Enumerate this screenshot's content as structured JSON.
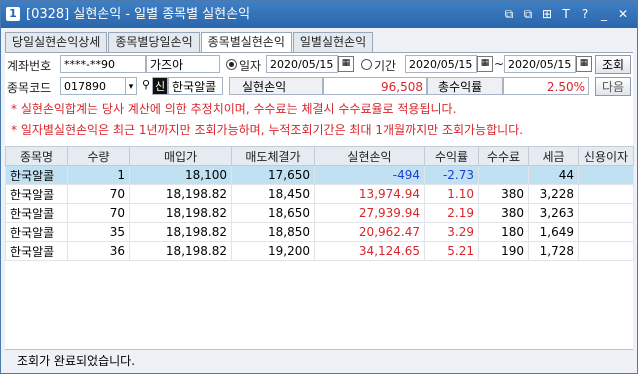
{
  "window": {
    "number": "1",
    "title": "[0328] 실현손익 - 일별 종목별 실현손익"
  },
  "titlebar_icons": [
    "window-restore-icon",
    "copy-icon",
    "pin-icon",
    "font-icon",
    "help-icon",
    "minimize-icon",
    "close-icon"
  ],
  "titlebar_icon_glyphs": [
    "⧉",
    "⧉",
    "⊞",
    "T",
    "?",
    "_",
    "✕"
  ],
  "tabs": [
    "당일실현손익상세",
    "종목별당일손익",
    "종목별실현손익",
    "일별실현손익"
  ],
  "active_tab": 2,
  "form": {
    "account_label": "계좌번호",
    "account_value": "****-**90",
    "account_name": "가즈아",
    "radio_date_label": "일자",
    "radio_period_label": "기간",
    "date_single": "2020/05/15",
    "date_from": "2020/05/15",
    "date_sep": "~",
    "date_to": "2020/05/15",
    "query_button": "조회",
    "next_button": "다음",
    "code_label": "종목코드",
    "code_value": "017890",
    "credit_tag": "신",
    "stock_name": "한국알콜",
    "realized_label": "실현손익",
    "realized_value": "96,508",
    "return_label": "총수익률",
    "return_value": "2.50%"
  },
  "notices": [
    "* 실현손익합계는 당사 계산에 의한 추정치이며, 수수료는 체결시 수수료율로 적용됩니다.",
    "* 일자별실현손익은 최근 1년까지만 조회가능하며, 누적조회기간은 최대 1개월까지만 조회가능합니다."
  ],
  "table": {
    "headers": [
      "종목명",
      "수량",
      "매입가",
      "매도체결가",
      "실현손익",
      "수익률",
      "수수료",
      "세금",
      "신용이자"
    ],
    "rows": [
      {
        "name": "한국알콜",
        "qty": "1",
        "buy": "18,100",
        "sell": "17,650",
        "pnl": "-494",
        "rate": "-2.73",
        "fee": "",
        "tax": "44",
        "interest": "",
        "sign": "neg"
      },
      {
        "name": "한국알콜",
        "qty": "70",
        "buy": "18,198.82",
        "sell": "18,450",
        "pnl": "13,974.94",
        "rate": "1.10",
        "fee": "380",
        "tax": "3,228",
        "interest": "",
        "sign": "pos"
      },
      {
        "name": "한국알콜",
        "qty": "70",
        "buy": "18,198.82",
        "sell": "18,650",
        "pnl": "27,939.94",
        "rate": "2.19",
        "fee": "380",
        "tax": "3,263",
        "interest": "",
        "sign": "pos"
      },
      {
        "name": "한국알콜",
        "qty": "35",
        "buy": "18,198.82",
        "sell": "18,850",
        "pnl": "20,962.47",
        "rate": "3.29",
        "fee": "180",
        "tax": "1,649",
        "interest": "",
        "sign": "pos"
      },
      {
        "name": "한국알콜",
        "qty": "36",
        "buy": "18,198.82",
        "sell": "19,200",
        "pnl": "34,124.65",
        "rate": "5.21",
        "fee": "190",
        "tax": "1,728",
        "interest": "",
        "sign": "pos"
      }
    ]
  },
  "status_text": "조회가 완료되었습니다."
}
